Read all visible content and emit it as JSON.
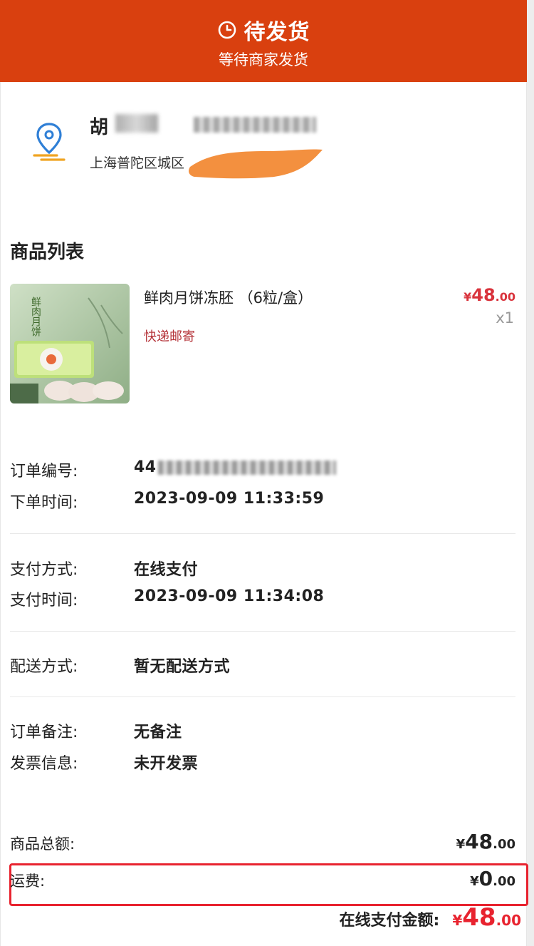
{
  "header": {
    "status_title": "待发货",
    "status_subtitle": "等待商家发货",
    "icon": "clock-icon",
    "background": "#d9400f"
  },
  "address": {
    "name": "胡",
    "address_text": "上海普陀区城区",
    "icon": "location-pin-icon"
  },
  "products_section": {
    "title": "商品列表",
    "items": [
      {
        "name": "鲜肉月饼冻胚 （6粒/盒）",
        "shipping": "快递邮寄",
        "price_currency": "¥",
        "price_int": "48",
        "price_dec": ".00",
        "quantity": "x1",
        "thumbnail_text": "鲜肉月饼"
      }
    ]
  },
  "order_info": {
    "order_number_label": "订单编号:",
    "order_number_prefix": "44",
    "order_time_label": "下单时间:",
    "order_time": "2023-09-09 11:33:59",
    "pay_method_label": "支付方式:",
    "pay_method": "在线支付",
    "pay_time_label": "支付时间:",
    "pay_time": "2023-09-09 11:34:08",
    "delivery_label": "配送方式:",
    "delivery": "暂无配送方式",
    "remark_label": "订单备注:",
    "remark": "无备注",
    "invoice_label": "发票信息:",
    "invoice": "未开发票"
  },
  "summary": {
    "goods_total_label": "商品总额:",
    "goods_total_cur": "¥",
    "goods_total_int": "48",
    "goods_total_dec": ".00",
    "freight_label": "运费:",
    "freight_cur": "¥",
    "freight_int": "0",
    "freight_dec": ".00",
    "online_pay_label": "在线支付金额:",
    "online_pay_cur": "¥",
    "online_pay_int": "48",
    "online_pay_dec": ".00"
  },
  "colors": {
    "accent": "#d9400f",
    "price_red": "#d9333c",
    "highlight_border": "#e8232f",
    "shipping_text": "#b5343a"
  }
}
